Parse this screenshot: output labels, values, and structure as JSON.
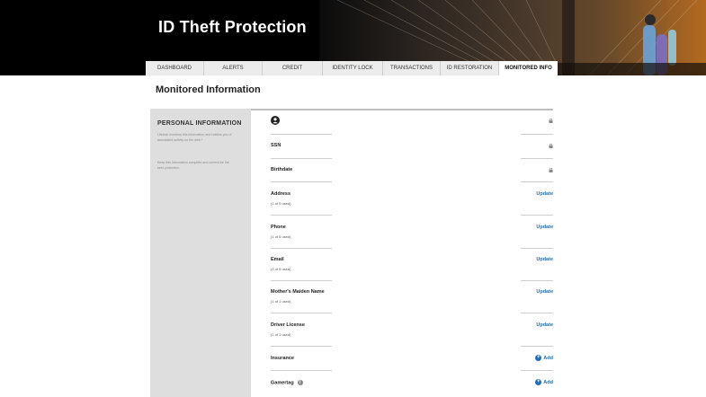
{
  "banner": {
    "title": "ID Theft Protection"
  },
  "tabs": [
    {
      "label": "DASHBOARD",
      "active": false
    },
    {
      "label": "ALERTS",
      "active": false
    },
    {
      "label": "CREDIT",
      "active": false
    },
    {
      "label": "IDENTITY LOCK",
      "active": false
    },
    {
      "label": "TRANSACTIONS",
      "active": false
    },
    {
      "label": "ID RESTORATION",
      "active": false
    },
    {
      "label": "MONITORED INFO",
      "active": true
    }
  ],
  "page": {
    "title": "Monitored Information"
  },
  "sidebar": {
    "heading": "PERSONAL INFORMATION",
    "paragraph1": "Lifelock monitors this information and notifies you of associated activity on the web.*",
    "paragraph2": "Keep this information complete and current for the best protection."
  },
  "items": [
    {
      "label": "",
      "sub": "",
      "action": "lock-icon"
    },
    {
      "label": "SSN",
      "sub": "",
      "action": "lock-icon"
    },
    {
      "label": "Birthdate",
      "sub": "",
      "action": "lock-icon"
    },
    {
      "label": "Address",
      "sub": "(1 of 5 used)",
      "action": "Update"
    },
    {
      "label": "Phone",
      "sub": "(1 of 5 used)",
      "action": "Update"
    },
    {
      "label": "Email",
      "sub": "(1 of 5 used)",
      "action": "Update"
    },
    {
      "label": "Mother's Maiden Name",
      "sub": "(1 of 1 used)",
      "action": "Update"
    },
    {
      "label": "Driver License",
      "sub": "(1 of 1 used)",
      "action": "Update"
    },
    {
      "label": "Insurance",
      "sub": "",
      "action": "Add"
    },
    {
      "label": "Gamertag",
      "sub": "",
      "action": "Add"
    }
  ],
  "colors": {
    "link": "#1d6fb8",
    "sidebar": "#dedede",
    "banner": "#000000"
  }
}
